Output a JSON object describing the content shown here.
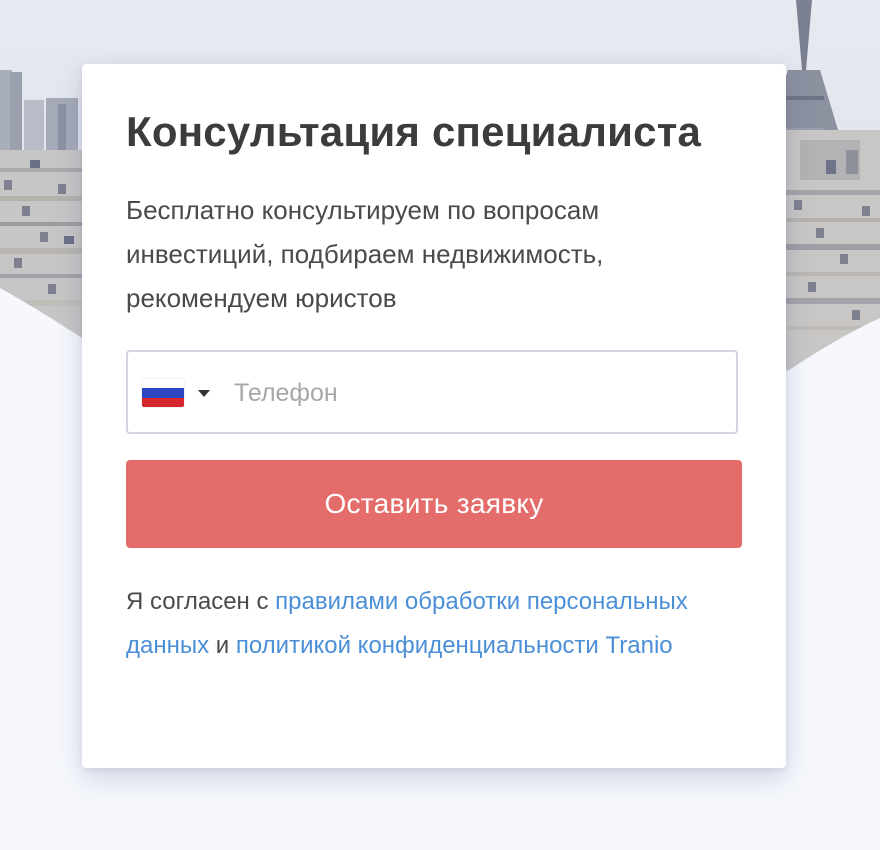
{
  "colors": {
    "page_background": "#f6f8fd",
    "card_background": "#ffffff",
    "title": "#3c3c3c",
    "body_text": "#4a4a4a",
    "placeholder": "#a7a7a7",
    "input_border": "#d2d6de",
    "button": "#e46c6a",
    "button_text": "#ffffff",
    "link": "#4b8fd7"
  },
  "background": {
    "image": "paris-cityscape-with-eiffel-tower"
  },
  "card": {
    "title": "Консультация специалиста",
    "subtitle": "Бесплатно консультируем по вопросам инвестиций, подбираем недвижимость, рекомендуем юристов"
  },
  "phone": {
    "country_flag": "russia-flag-icon",
    "dropdown_icon": "caret-down-icon",
    "placeholder": "Телефон",
    "value": ""
  },
  "submit": {
    "label": "Оставить заявку"
  },
  "consent": {
    "prefix": "Я согласен с ",
    "link1": "правилами обработки персональных данных",
    "conjunction": " и ",
    "link2": "политикой конфиденциальности Tranio"
  }
}
